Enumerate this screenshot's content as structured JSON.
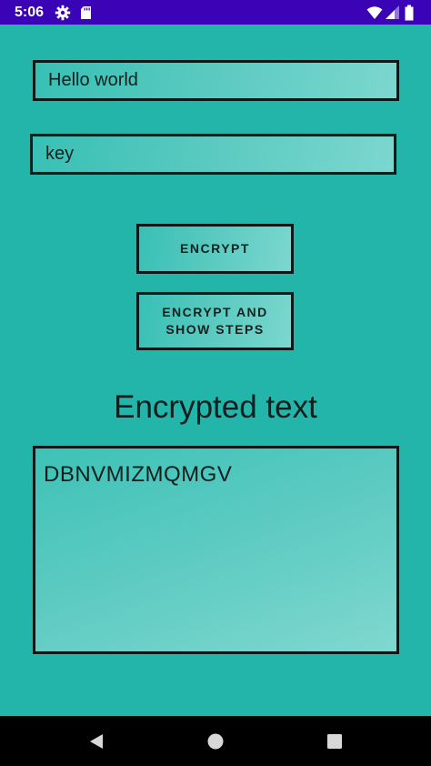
{
  "status_bar": {
    "time": "5:06",
    "icons": [
      "gear-icon",
      "sd-card-icon",
      "wifi-icon",
      "cellular-signal-icon",
      "battery-icon"
    ]
  },
  "form": {
    "plaintext_value": "Hello world",
    "key_value": "key"
  },
  "buttons": {
    "encrypt_label": "ENCRYPT",
    "encrypt_steps_label_line1": "ENCRYPT AND",
    "encrypt_steps_label_line2": "SHOW STEPS"
  },
  "output": {
    "heading": "Encrypted text",
    "value": "DBNVMIZMQMGV"
  },
  "nav_bar": {
    "icons": [
      "back-icon",
      "home-icon",
      "recents-icon"
    ]
  },
  "colors": {
    "status_bar": "#3a04b6",
    "background": "#24b5aa",
    "field_light": "#7bd7cf",
    "border": "#0b1a19",
    "nav_bar": "#000000"
  }
}
